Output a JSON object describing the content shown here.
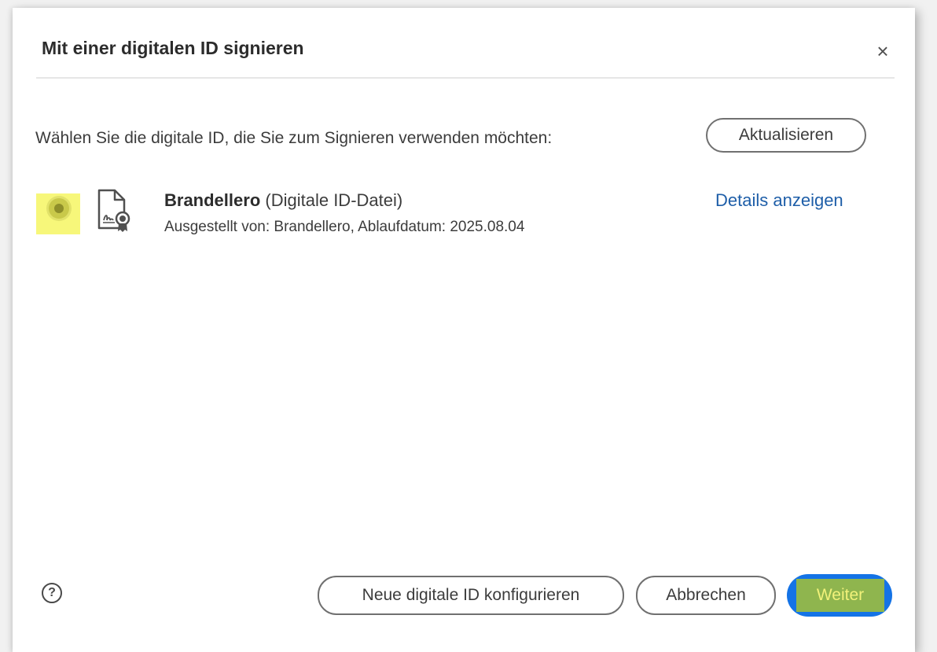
{
  "dialog": {
    "title": "Mit einer digitalen ID signieren",
    "close_label": "×",
    "prompt": "Wählen Sie die digitale ID, die Sie zum Signieren verwenden möchten:",
    "refresh_label": "Aktualisieren"
  },
  "digital_id": {
    "selected": true,
    "name": "Brandellero",
    "type": "(Digitale ID-Datei)",
    "issued_info": "Ausgestellt von: Brandellero, Ablaufdatum: 2025.08.04",
    "details_label": "Details anzeigen",
    "icon": "certificate-file-icon"
  },
  "footer": {
    "help_label": "?",
    "new_id_label": "Neue digitale ID konfigurieren",
    "cancel_label": "Abbrechen",
    "next_label": "Weiter"
  },
  "colors": {
    "accent": "#1473e6",
    "link": "#1e5ea8",
    "highlight_yellow": "#f7f77a",
    "highlight_green": "#8fb54e"
  }
}
